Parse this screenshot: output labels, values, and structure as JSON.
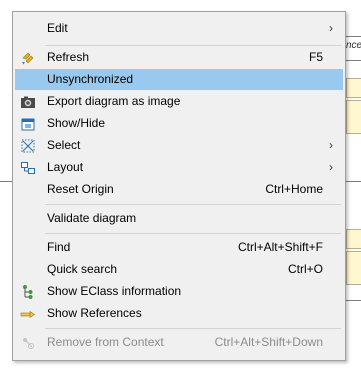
{
  "background": {
    "caption_fragment": "nce"
  },
  "menu": {
    "items": [
      {
        "label": "Edit",
        "has_submenu": true
      },
      {
        "label": "Refresh",
        "shortcut": "F5",
        "icon": "refresh-icon"
      },
      {
        "label": "Unsynchronized",
        "selected": true
      },
      {
        "label": "Export diagram as image",
        "icon": "camera-icon"
      },
      {
        "label": "Show/Hide",
        "icon": "show-hide-icon"
      },
      {
        "label": "Select",
        "has_submenu": true,
        "icon": "select-icon"
      },
      {
        "label": "Layout",
        "has_submenu": true,
        "icon": "layout-icon"
      },
      {
        "label": "Reset Origin",
        "shortcut": "Ctrl+Home"
      },
      {
        "label": "Validate diagram"
      },
      {
        "label": "Find",
        "shortcut": "Ctrl+Alt+Shift+F"
      },
      {
        "label": "Quick search",
        "shortcut": "Ctrl+O"
      },
      {
        "label": "Show EClass information",
        "icon": "eclass-tree-icon"
      },
      {
        "label": "Show References",
        "icon": "references-icon"
      },
      {
        "label": "Remove from Context",
        "shortcut": "Ctrl+Alt+Shift+Down",
        "disabled": true,
        "icon": "remove-context-icon"
      }
    ],
    "submenu_arrow": "›"
  }
}
